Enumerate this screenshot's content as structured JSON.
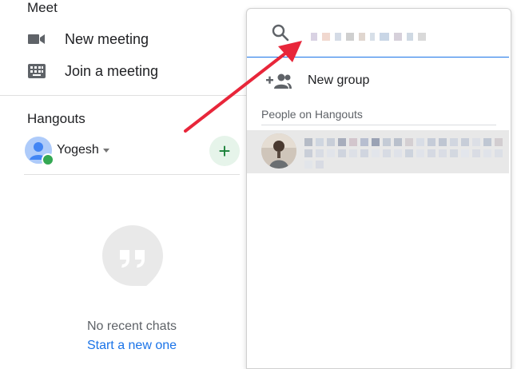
{
  "meet": {
    "title": "Meet",
    "items": [
      {
        "label": "New meeting",
        "icon": "video-camera-icon"
      },
      {
        "label": "Join a meeting",
        "icon": "keyboard-icon"
      }
    ]
  },
  "hangouts": {
    "title": "Hangouts",
    "user": {
      "name": "Yogesh",
      "status": "online"
    },
    "empty_state": {
      "message": "No recent chats",
      "link": "Start a new one"
    }
  },
  "popup": {
    "search": {
      "value": "",
      "icon": "search-icon"
    },
    "new_group_label": "New group",
    "section_label": "People on Hangouts",
    "contacts": [
      {
        "name_redacted": true
      }
    ]
  },
  "colors": {
    "accent_blue": "#1a73e8",
    "online_green": "#34a853",
    "add_green": "#188038",
    "annotation_red": "#e8263a",
    "selected_row": "#e8e8e8"
  }
}
